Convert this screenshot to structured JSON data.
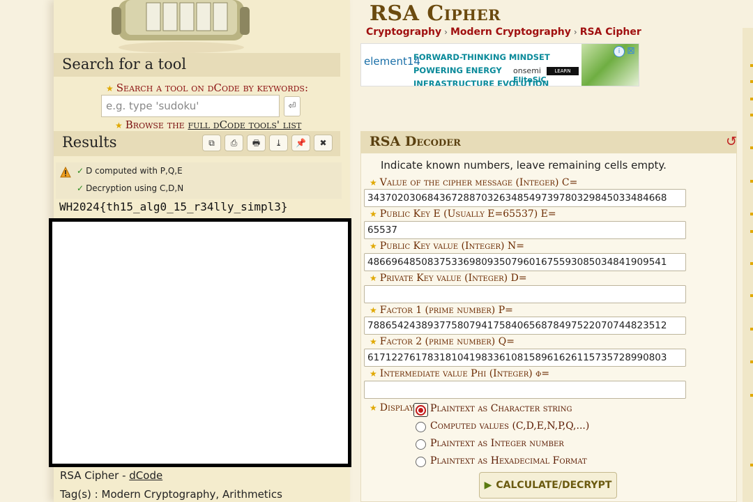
{
  "left": {
    "search": {
      "heading": "Search for a tool",
      "label": "Search a tool on dCode by keywords:",
      "placeholder": "e.g. type 'sudoku'",
      "submit_icon": "return-icon",
      "browse_prefix": "Browse the ",
      "browse_link": "full dCode tools' list"
    },
    "results": {
      "heading": "Results",
      "toolbar": [
        {
          "name": "copy-button",
          "icon": "copy-icon",
          "glyph": "⧉"
        },
        {
          "name": "save-button",
          "icon": "save-icon",
          "glyph": "⎙"
        },
        {
          "name": "print-button",
          "icon": "print-icon",
          "glyph": "🖶"
        },
        {
          "name": "download-button",
          "icon": "download-icon",
          "glyph": "⤓"
        },
        {
          "name": "pin-button",
          "icon": "pin-icon",
          "glyph": "📌"
        },
        {
          "name": "close-button",
          "icon": "close-icon",
          "glyph": "✖"
        }
      ],
      "lines": [
        "D computed with P,Q,E",
        "Decryption using C,D,N"
      ],
      "output": "WH2024{th15_alg0_15_r34lly_simpl3}"
    },
    "caption": {
      "prefix": "RSA Cipher - ",
      "link": "dCode"
    },
    "tags": "Tag(s) : Modern Cryptography, Arithmetics"
  },
  "main": {
    "title": "RSA Cipher",
    "breadcrumb": [
      "Cryptography",
      "Modern Cryptography",
      "RSA Cipher"
    ],
    "ad": {
      "brand": "element14",
      "text_line1": "FORWARD-THINKING MINDSET POWERING ENERGY",
      "text_line2": "INFRASTRUCTURE EVOLUTION",
      "sponsor": "onsemi",
      "sub": "EliteSiC",
      "cta": "LEARN MORE"
    },
    "decoder": {
      "heading": "RSA Decoder",
      "hint": "Indicate known numbers, leave remaining cells empty.",
      "fields": [
        {
          "label": "Value of the cipher message (Integer) C=",
          "value": "34370203068436728870326348549739780329845033484668"
        },
        {
          "label": "Public Key E (Usually E=65537) E=",
          "value": "65537"
        },
        {
          "label": "Public Key value (Integer) N=",
          "value": "48669648508375336980935079601675593085034841909541"
        },
        {
          "label": "Private Key value (Integer) D=",
          "value": ""
        },
        {
          "label": "Factor 1 (prime number) P=",
          "value": "78865424389377580794175840656878497522070744823512"
        },
        {
          "label": "Factor 2 (prime number) Q=",
          "value": "61712276178318104198336108158961626115735728990803"
        },
        {
          "label": "Intermediate value Phi (Integer) φ=",
          "value": ""
        }
      ],
      "display_label": "Display",
      "options": [
        "Plaintext as Character string",
        "Computed values (C,D,E,N,P,Q,...)",
        "Plaintext as Integer number",
        "Plaintext as Hexadecimal Format"
      ],
      "selected_option": 0,
      "button": "CALCULATE/DECRYPT"
    }
  },
  "colors": {
    "background": "#f7f1df",
    "panel_head": "#e7dcb8",
    "link_red": "#a01010",
    "title_brown": "#6b4a0f",
    "star": "#e0a800"
  }
}
